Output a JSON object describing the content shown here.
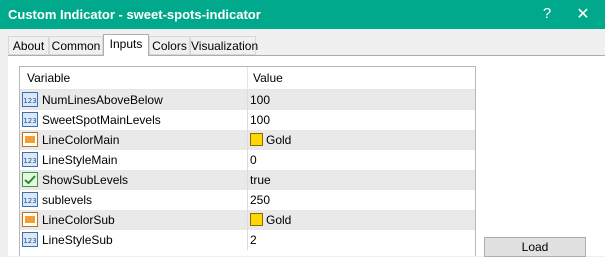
{
  "window": {
    "title": "Custom Indicator - sweet-spots-indicator",
    "help_glyph": "?",
    "close_glyph": "✕"
  },
  "tabs": [
    {
      "label": "About"
    },
    {
      "label": "Common"
    },
    {
      "label": "Inputs",
      "active": true
    },
    {
      "label": "Colors"
    },
    {
      "label": "Visualization"
    }
  ],
  "grid": {
    "headers": {
      "variable": "Variable",
      "value": "Value"
    },
    "rows": [
      {
        "variable": "NumLinesAboveBelow",
        "value": "100",
        "icon": "number-icon"
      },
      {
        "variable": "SweetSpotMainLevels",
        "value": "100",
        "icon": "number-icon"
      },
      {
        "variable": "LineColorMain",
        "value": "Gold",
        "icon": "color-icon",
        "swatch": "#ffd700"
      },
      {
        "variable": "LineStyleMain",
        "value": "0",
        "icon": "number-icon"
      },
      {
        "variable": "ShowSubLevels",
        "value": "true",
        "icon": "boolean-icon"
      },
      {
        "variable": "sublevels",
        "value": "250",
        "icon": "number-icon"
      },
      {
        "variable": "LineColorSub",
        "value": "Gold",
        "icon": "color-icon",
        "swatch": "#ffd700"
      },
      {
        "variable": "LineStyleSub",
        "value": "2",
        "icon": "number-icon"
      }
    ]
  },
  "buttons": {
    "load": "Load"
  },
  "colors": {
    "titlebar": "#00a98b",
    "alt_row": "#e9e9e9",
    "swatch_gold": "#ffd700"
  }
}
